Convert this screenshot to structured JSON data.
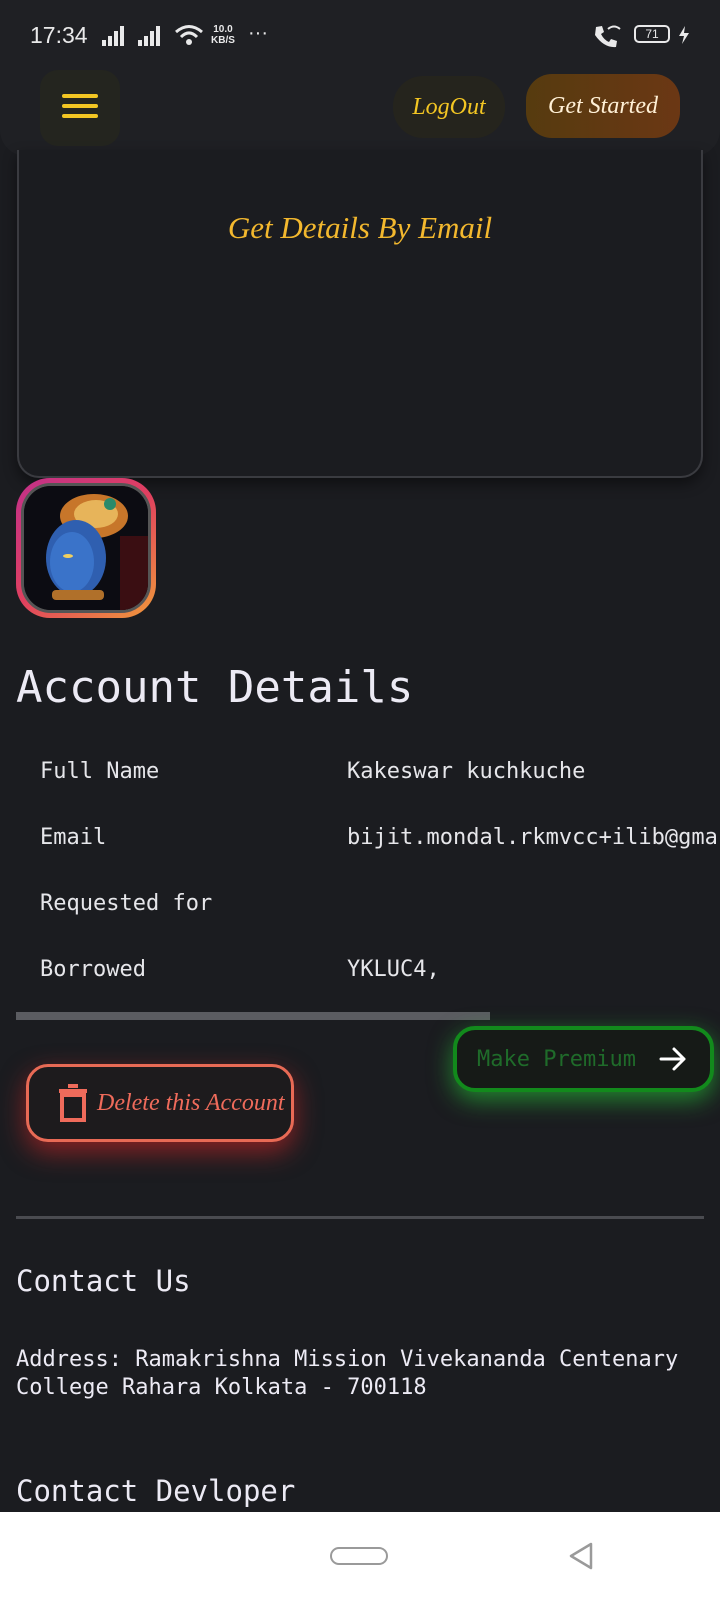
{
  "status_bar": {
    "time": "17:34",
    "net_speed_value": "10.0",
    "net_speed_unit": "KB/S",
    "overflow": "···",
    "battery": "71"
  },
  "navbar": {
    "logout_label": "LogOut",
    "get_started_label": "Get Started",
    "accent_color": "#f3c623"
  },
  "card": {
    "title": "Get Details By Email"
  },
  "account": {
    "heading": "Account Details",
    "rows": [
      {
        "label": "Full Name",
        "value": "Kakeswar kuchkuche"
      },
      {
        "label": "Email",
        "value": "bijit.mondal.rkmvcc+ilib@gma"
      },
      {
        "label": "Requested for",
        "value": ""
      },
      {
        "label": "Borrowed",
        "value": "YKLUC4,"
      }
    ]
  },
  "actions": {
    "delete_label": "Delete this Account",
    "premium_label": "Make Premium"
  },
  "footer": {
    "contact_heading": "Contact Us",
    "address": "Address: Ramakrishna Mission Vivekananda Centenary College Rahara Kolkata - 700118",
    "developer_heading": "Contact Devloper"
  }
}
